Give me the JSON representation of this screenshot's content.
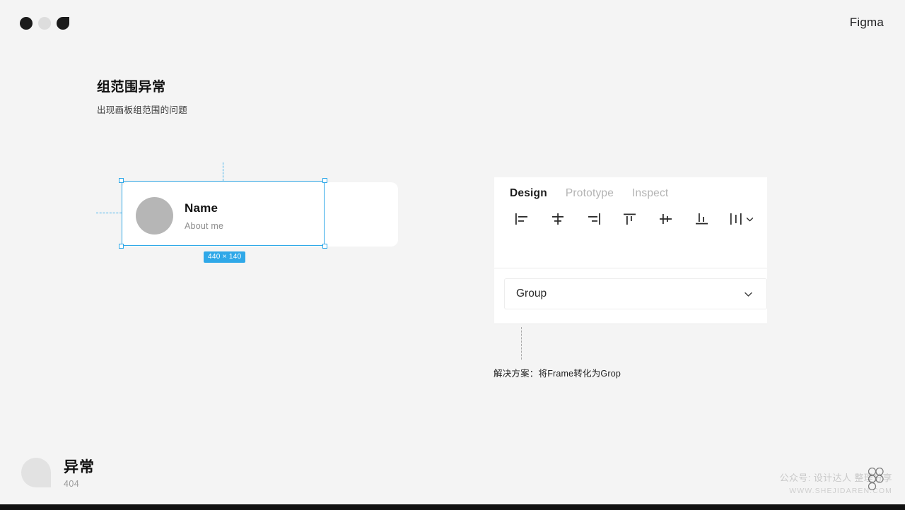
{
  "window": {
    "dots": [
      {
        "name": "dot-dark",
        "style": "circle-dark"
      },
      {
        "name": "dot-light",
        "style": "circle-light"
      },
      {
        "name": "dot-notch",
        "style": "circle-notched-dark"
      }
    ],
    "brand": "Figma",
    "background_color": "#f4f4f4"
  },
  "heading": {
    "title": "组范围异常",
    "subtitle": "出现画板组范围的问题"
  },
  "card": {
    "name": "Name",
    "about": "About me",
    "avatar_color": "#b6b6b6",
    "background": "#ffffff"
  },
  "selection": {
    "accent_color": "#2fa8e8",
    "dimension_badge": "440 × 140",
    "handles": [
      "top-left",
      "top-right",
      "bottom-left",
      "bottom-right"
    ]
  },
  "panel": {
    "tabs": [
      {
        "label": "Design",
        "active": true
      },
      {
        "label": "Prototype",
        "active": false
      },
      {
        "label": "Inspect",
        "active": false
      }
    ],
    "align_tools": [
      {
        "icon": "align-left-icon"
      },
      {
        "icon": "align-horizontal-center-icon"
      },
      {
        "icon": "align-right-icon"
      },
      {
        "icon": "align-top-icon"
      },
      {
        "icon": "align-vertical-center-icon"
      },
      {
        "icon": "align-bottom-icon"
      },
      {
        "icon": "distribute-icon"
      }
    ],
    "group_select": {
      "value": "Group",
      "chevron": "chevron-down-icon"
    }
  },
  "solution": {
    "text": "解决方案：将Frame转化为Grop"
  },
  "footer": {
    "title": "异常",
    "code": "404"
  },
  "watermark": {
    "line1": "公众号: 设计达人 整理分享",
    "line2": "WWW.SHEJIDAREN.COM"
  }
}
